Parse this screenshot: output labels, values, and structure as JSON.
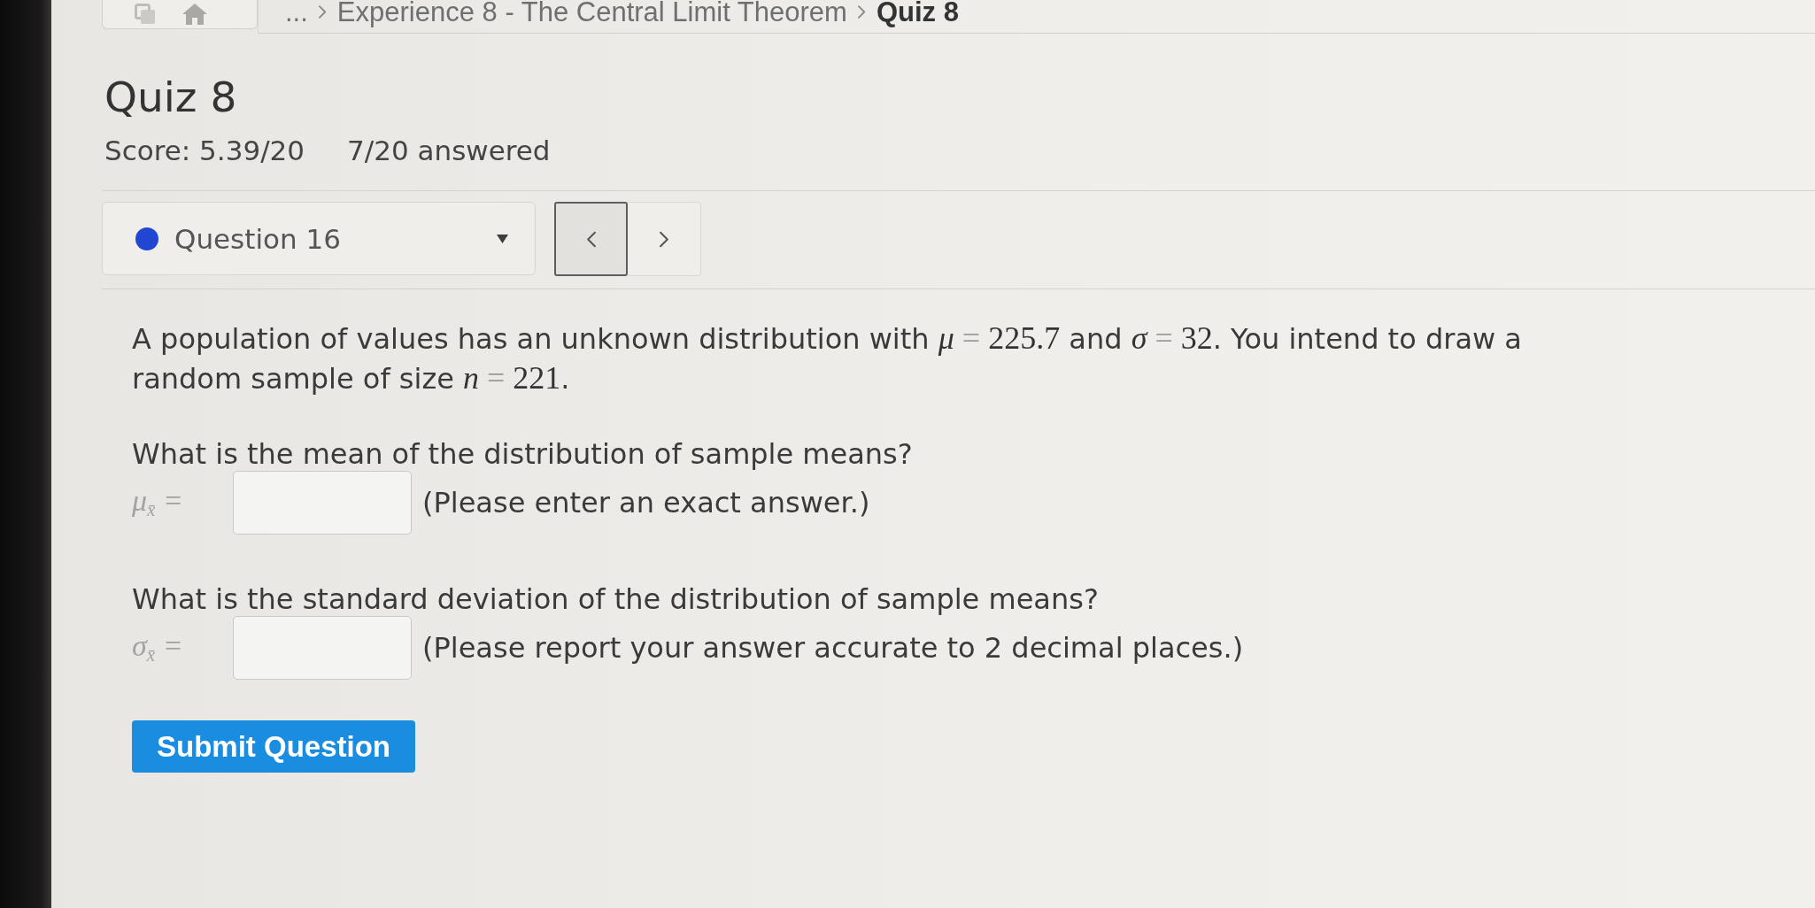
{
  "breadcrumb": [
    {
      "label": "...",
      "current": false
    },
    {
      "label": "Experience 8 - The Central Limit Theorem",
      "current": false
    },
    {
      "label": "Quiz 8",
      "current": true
    }
  ],
  "quiz": {
    "title": "Quiz 8",
    "score": "Score: 5.39/20",
    "progress": "7/20 answered"
  },
  "question_nav": {
    "label": "Question 16",
    "color": "#2146d2",
    "buttons": [
      {
        "kind": "previous",
        "focused": true
      },
      {
        "kind": "next",
        "focused": false
      }
    ]
  },
  "question": {
    "intro": [
      {
        "kind": "text",
        "text": "A population of values has an unknown distribution with "
      },
      {
        "kind": "var",
        "text": "μ"
      },
      {
        "kind": "op",
        "text": " = "
      },
      {
        "kind": "num",
        "text": "225.7"
      },
      {
        "kind": "text",
        "text": " and "
      },
      {
        "kind": "var",
        "text": "σ"
      },
      {
        "kind": "op",
        "text": " = "
      },
      {
        "kind": "num",
        "text": "32"
      },
      {
        "kind": "text",
        "text": ". You intend to draw a random sample of size "
      },
      {
        "kind": "var",
        "text": "n"
      },
      {
        "kind": "op",
        "text": " = "
      },
      {
        "kind": "num",
        "text": "221"
      },
      {
        "kind": "text",
        "text": "."
      }
    ],
    "parts": [
      {
        "prompt": "What is the mean of the distribution of sample means?",
        "label": "μ$_{x̄}$ =",
        "hint": "(Please enter an exact answer.)"
      },
      {
        "prompt": "What is the standard deviation of the distribution of sample means?",
        "label": "σ$_{x̄}$ =",
        "hint": "(Please report your answer accurate to 2 decimal places.)"
      }
    ],
    "submit": "Submit Question"
  }
}
